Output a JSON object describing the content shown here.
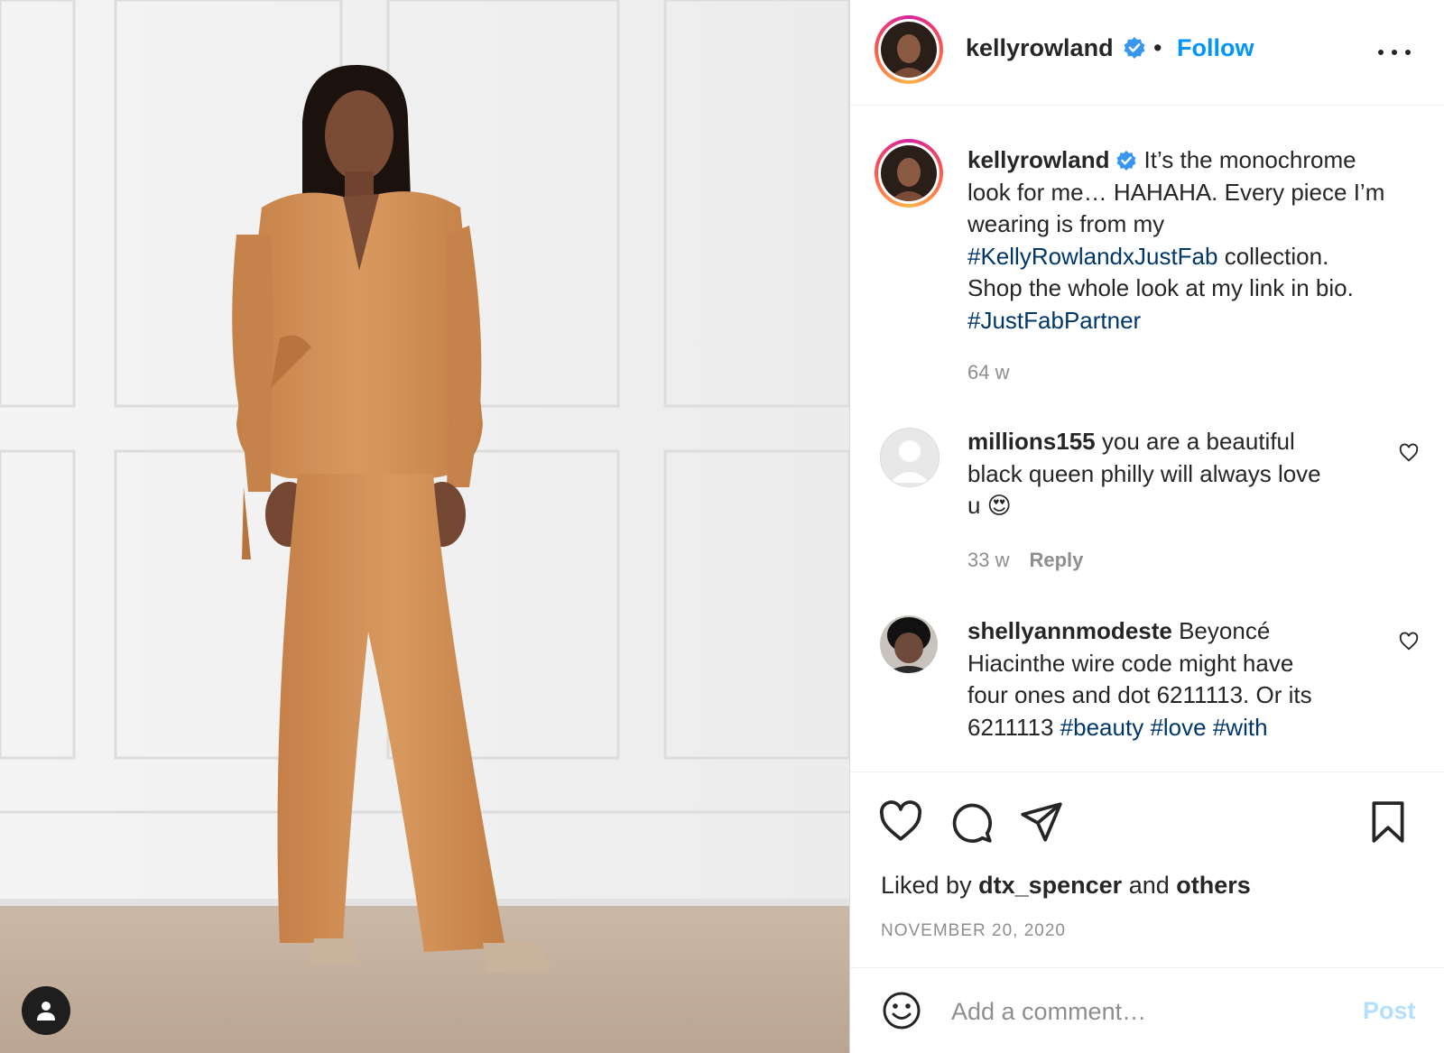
{
  "post": {
    "author": "kellyrowland",
    "follow_label": "Follow",
    "dot": "•",
    "caption": {
      "username": "kellyrowland",
      "line1": "It’s the monochrome",
      "line2": "look for me… HAHAHA. Every piece I’m",
      "line3": "wearing is from my",
      "hashtag1": "#KellyRowlandxJustFab",
      "line4_rest": " collection.",
      "line5": "Shop the whole look at my link in bio.",
      "hashtag2": "#JustFabPartner",
      "age": "64 w"
    },
    "comments": [
      {
        "username": "millions155",
        "text1": "you are a beautiful",
        "text2": "black queen philly will always love",
        "text3": "u 😍",
        "age": "33 w",
        "reply_label": "Reply"
      },
      {
        "username": "shellyannmodeste",
        "text1": "Beyoncé",
        "text2": "Hiacinthe wire code might have",
        "text3": "four ones and dot 6211113. Or its",
        "text4": "6211113",
        "tags": [
          "#beauty",
          "#love",
          "#with"
        ]
      }
    ],
    "likes": {
      "prefix": "Liked by",
      "user": "dtx_spencer",
      "middle": "and",
      "others": "others"
    },
    "date": "NOVEMBER 20, 2020",
    "comment_box": {
      "placeholder": "Add a comment…",
      "post_label": "Post"
    }
  },
  "colors": {
    "link_blue": "#0095f6",
    "hashtag": "#00376b",
    "muted": "#8e8e8e",
    "outfit": "#d3955c"
  },
  "icons": [
    "user-tag-icon",
    "verified-badge-icon",
    "more-options-icon",
    "heart-icon",
    "comment-icon",
    "share-icon",
    "bookmark-icon",
    "emoji-icon"
  ]
}
